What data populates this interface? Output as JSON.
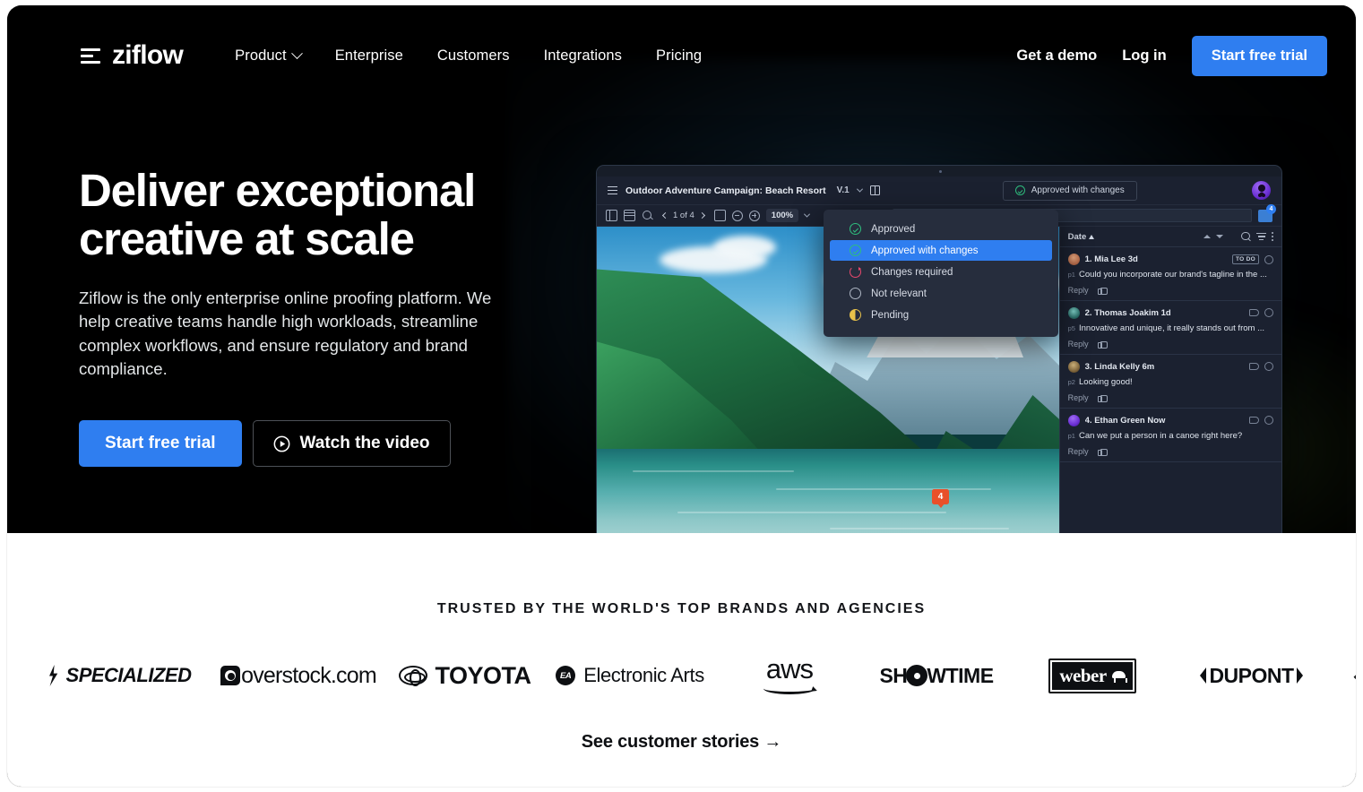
{
  "brand": {
    "name": "ziflow",
    "mark_icon": "ziflow-logo-icon"
  },
  "nav": {
    "links": [
      {
        "label": "Product",
        "has_chevron": true
      },
      {
        "label": "Enterprise",
        "has_chevron": false
      },
      {
        "label": "Customers",
        "has_chevron": false
      },
      {
        "label": "Integrations",
        "has_chevron": false
      },
      {
        "label": "Pricing",
        "has_chevron": false
      }
    ],
    "demo_label": "Get a demo",
    "login_label": "Log in",
    "cta_label": "Start free trial"
  },
  "hero": {
    "title": "Deliver exceptional creative at scale",
    "subtitle": "Ziflow is the only enterprise online proofing platform. We help creative teams handle high workloads, streamline complex workflows, and ensure regulatory and brand compliance.",
    "primary_cta": "Start free trial",
    "secondary_cta": "Watch the video",
    "play_icon": "play-circle-icon",
    "accent_color": "#2f7ef0",
    "background_color": "#000000"
  },
  "app_mockup": {
    "doc_title": "Outdoor Adventure Campaign: Beach Resort",
    "version": "V.1",
    "status_pill": "Approved with changes",
    "pager": "1 of 4",
    "zoom": "100%",
    "marker_number": "4",
    "toolbar_badge_count": "4",
    "status_menu": [
      {
        "label": "Approved",
        "icon": "check-circle-icon",
        "selected": false
      },
      {
        "label": "Approved with changes",
        "icon": "check-circle-icon",
        "selected": true
      },
      {
        "label": "Changes required",
        "icon": "redo-circle-icon",
        "selected": false
      },
      {
        "label": "Not relevant",
        "icon": "empty-circle-icon",
        "selected": false
      },
      {
        "label": "Pending",
        "icon": "half-circle-icon",
        "selected": false
      }
    ],
    "comments_header": {
      "sort_label": "Date",
      "sort_direction_icon": "arrow-up-icon",
      "search_icon": "search-icon",
      "filter_icon": "filter-icon",
      "more_icon": "more-vertical-icon"
    },
    "comments": [
      {
        "name": "1. Mia Lee 3d",
        "page": "p1",
        "text": "Could you incorporate our brand's tagline in the ...",
        "badge": "TO DO",
        "reply_label": "Reply"
      },
      {
        "name": "2. Thomas Joakim 1d",
        "page": "p5",
        "text": "Innovative and unique, it really stands out from ...",
        "badge": "",
        "reply_label": "Reply"
      },
      {
        "name": "3. Linda Kelly 6m",
        "page": "p2",
        "text": "Looking good!",
        "badge": "",
        "reply_label": "Reply"
      },
      {
        "name": "4. Ethan Green Now",
        "page": "p1",
        "text": "Can we put a person in a canoe right here?",
        "badge": "",
        "reply_label": "Reply"
      }
    ]
  },
  "trusted": {
    "heading": "TRUSTED BY THE WORLD'S TOP BRANDS AND AGENCIES",
    "logos": [
      {
        "name": "Specialized"
      },
      {
        "name": "overstock.com"
      },
      {
        "name": "TOYOTA"
      },
      {
        "name": "Electronic Arts"
      },
      {
        "name": "aws"
      },
      {
        "name": "SHOWTIME"
      },
      {
        "name": "weber"
      },
      {
        "name": "DUPONT"
      }
    ],
    "ea_mark": "EA",
    "aws_word": "aws",
    "showtime_prefix": "SH",
    "showtime_suffix": "WTIME",
    "weber_word": "weber",
    "dupont_word": "DUPONT",
    "edge_left": "S",
    "edge_right": "◇",
    "stories_link": "See customer stories →"
  }
}
